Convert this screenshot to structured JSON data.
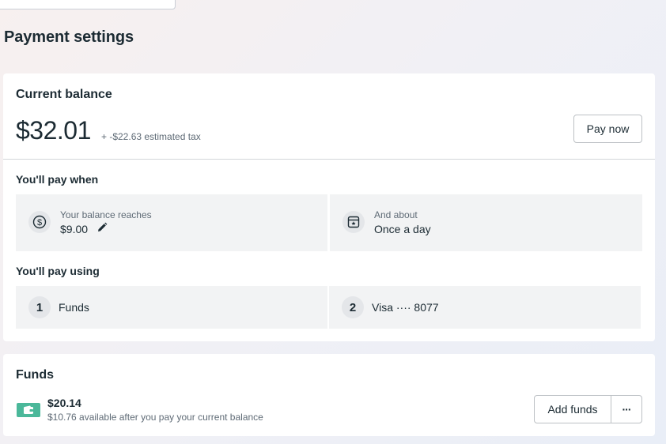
{
  "page": {
    "title": "Payment settings"
  },
  "balance_card": {
    "heading": "Current balance",
    "amount": "$32.01",
    "tax_note": "+ -$22.63 estimated tax",
    "pay_now_label": "Pay now",
    "pay_when": {
      "heading": "You'll pay when",
      "threshold": {
        "label": "Your balance reaches",
        "value": "$9.00",
        "icon": "dollar-circle-icon",
        "edit_icon": "pencil-icon"
      },
      "schedule": {
        "label": "And about",
        "value": "Once a day",
        "icon": "calendar-icon"
      }
    },
    "pay_using": {
      "heading": "You'll pay using",
      "methods": [
        {
          "order": "1",
          "label": "Funds"
        },
        {
          "order": "2",
          "label": "Visa ···· 8077"
        }
      ]
    }
  },
  "funds_card": {
    "heading": "Funds",
    "amount": "$20.14",
    "available_note": "$10.76 available after you pay your current balance",
    "add_funds_label": "Add funds",
    "more_label": "···",
    "icon": "wallet-icon",
    "icon_color": "#4bb89a"
  }
}
